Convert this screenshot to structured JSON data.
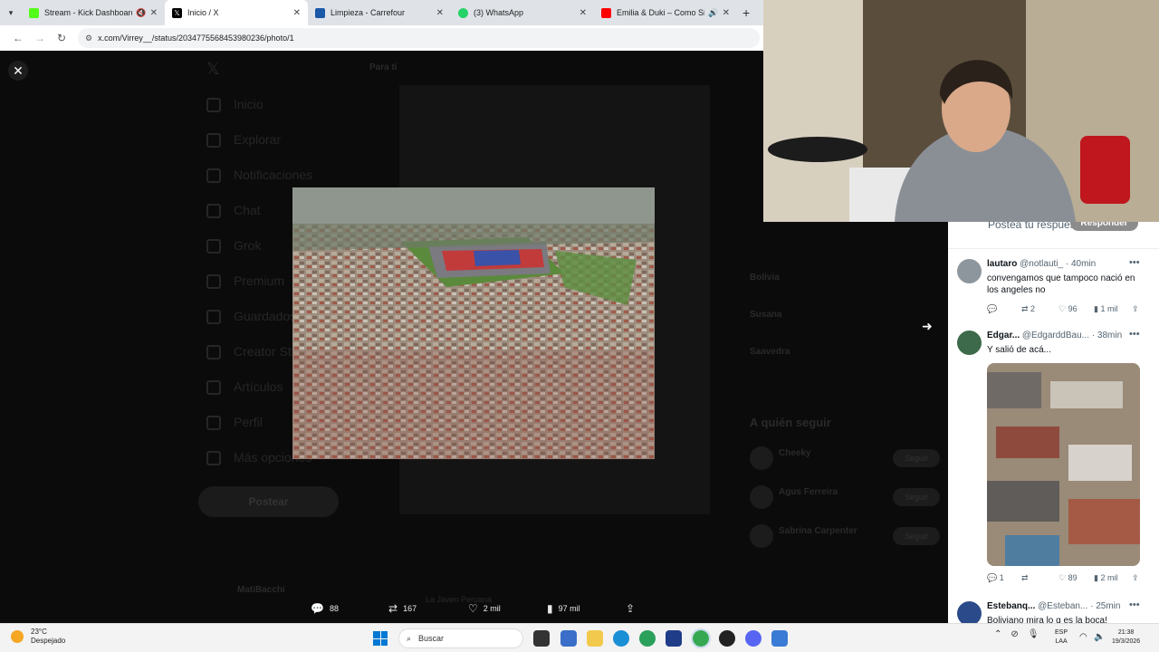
{
  "browser": {
    "tabs": [
      {
        "label": "Stream - Kick Dashboard",
        "color": "#53fc18",
        "muted": true
      },
      {
        "label": "Inicio / X",
        "color": "#000000",
        "active": true
      },
      {
        "label": "Limpieza - Carrefour",
        "color": "#1a58a8"
      },
      {
        "label": "(3) WhatsApp",
        "color": "#25d366"
      },
      {
        "label": "Emilia & Duki – Como Si No",
        "color": "#ff0000",
        "audio": true
      }
    ],
    "url": "x.com/Virrey__/status/2034775568453980236/photo/1"
  },
  "background": {
    "sidebar": [
      "Inicio",
      "Explorar",
      "Notificaciones",
      "Chat",
      "Grok",
      "Premium",
      "Guardados",
      "Creator Studio",
      "Artículos",
      "Perfil",
      "Más opciones"
    ],
    "post_button": "Postear",
    "account_name": "MatiBacchi",
    "feed_tab": "Para ti",
    "trends": [
      "Bolivia",
      "Susana",
      "Saavedra"
    ],
    "follow_title": "A quién seguir",
    "follow_names": [
      "Cheeky",
      "Agus Ferreira",
      "Sabrina Carpenter"
    ],
    "follow_label": "Seguir",
    "quoted_author": "La Javen Peruana"
  },
  "actions": {
    "replies": "88",
    "reposts": "167",
    "likes": "2 mil",
    "views": "97 mil"
  },
  "reply_compose": {
    "placeholder": "Postea tu respuesta",
    "button": "Responder"
  },
  "replies": [
    {
      "name": "lautaro",
      "handle": "@notlauti_",
      "time": "· 40min",
      "text": "convengamos que tampoco nació en los angeles no",
      "comments": "",
      "reposts": "2",
      "likes": "96",
      "views": "1 mil"
    },
    {
      "name": "Edgar...",
      "handle": "@EdgarddBau...",
      "time": "· 38min",
      "text": "Y salió de acá...",
      "comments": "1",
      "reposts": "",
      "likes": "89",
      "views": "2 mil"
    },
    {
      "name": "Estebanq...",
      "handle": "@Esteban...",
      "time": "· 25min",
      "text": "Boliviano mira lo q es la boca!"
    }
  ],
  "taskbar": {
    "temp": "23°C",
    "weather": "Despejado",
    "search": "Buscar",
    "lang1": "ESP",
    "lang2": "LAA",
    "time": "21:38",
    "date": "19/3/2026"
  }
}
